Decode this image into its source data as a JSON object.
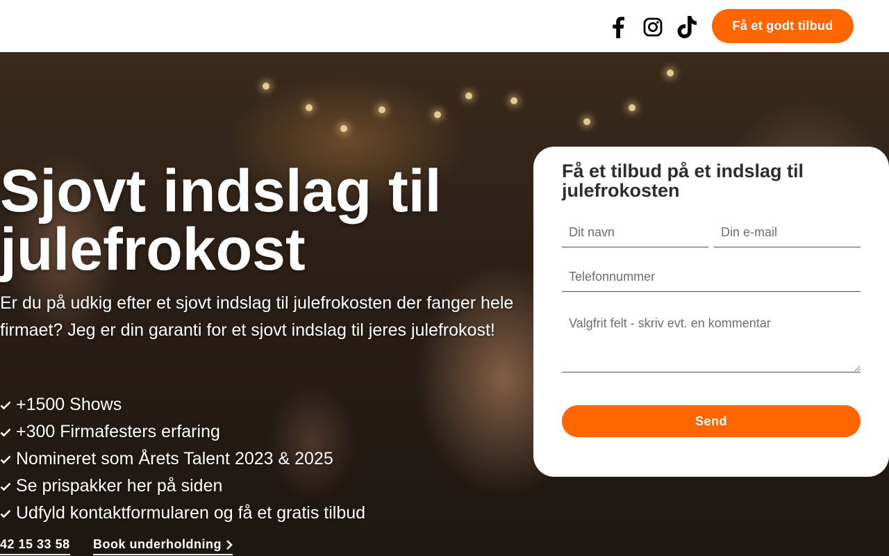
{
  "header": {
    "social": [
      {
        "name": "facebook-icon"
      },
      {
        "name": "instagram-icon"
      },
      {
        "name": "tiktok-icon"
      }
    ],
    "cta_label": "Få et godt tilbud"
  },
  "hero": {
    "title": "Sjovt indslag til julefrokost",
    "subtitle": "Er du på udkig efter et sjovt indslag til julefrokosten der fanger hele firmaet? Jeg er din garanti for et sjovt indslag til jeres julefrokost!",
    "bullets": [
      "+1500 Shows",
      "+300 Firmafesters erfaring",
      "Nomineret som Årets Talent 2023 & 2025",
      "Se prispakker her på siden",
      "Udfyld kontaktformularen og få et gratis tilbud"
    ],
    "phone": "42 15 33 58",
    "book_label": "Book underholdning"
  },
  "form": {
    "title": "Få et tilbud på et indslag til julefrokosten",
    "name_placeholder": "Dit navn",
    "email_placeholder": "Din e-mail",
    "phone_placeholder": "Telefonnummer",
    "comment_placeholder": "Valgfrit felt - skriv evt. en kommentar",
    "send_label": "Send"
  },
  "colors": {
    "accent": "#ff6600",
    "text_dark": "#2d2d2d",
    "white": "#ffffff"
  }
}
